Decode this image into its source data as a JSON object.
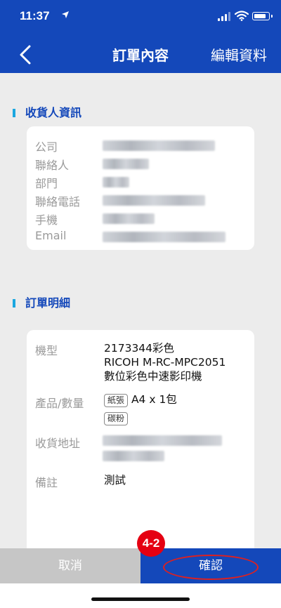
{
  "status": {
    "time": "11:37",
    "location_icon": "location-arrow-icon"
  },
  "nav": {
    "title": "訂單內容",
    "edit_label": "編輯資料",
    "back_icon": "chevron-left-icon"
  },
  "recipient": {
    "title": "收貨人資訊",
    "labels": [
      "公司",
      "聯絡人",
      "部門",
      "聯絡電話",
      "手機",
      "Email"
    ]
  },
  "order": {
    "title": "訂單明細",
    "model_label": "機型",
    "model_value_lines": [
      "2173344彩色",
      "RICOH M-RC-MPC2051",
      "數位彩色中速影印機"
    ],
    "product_label": "產品/數量",
    "paper_tag": "紙張",
    "paper_value": "A4 x 1包",
    "toner_tag": "碳粉",
    "address_label": "收貨地址",
    "note_label": "備註",
    "note_value": "測試"
  },
  "footer": {
    "cancel_label": "取消",
    "confirm_label": "確認"
  },
  "annotation": {
    "badge": "4-2"
  },
  "colors": {
    "brand": "#1448ba",
    "accent": "#1ba7e0",
    "annotation": "#e50012"
  }
}
